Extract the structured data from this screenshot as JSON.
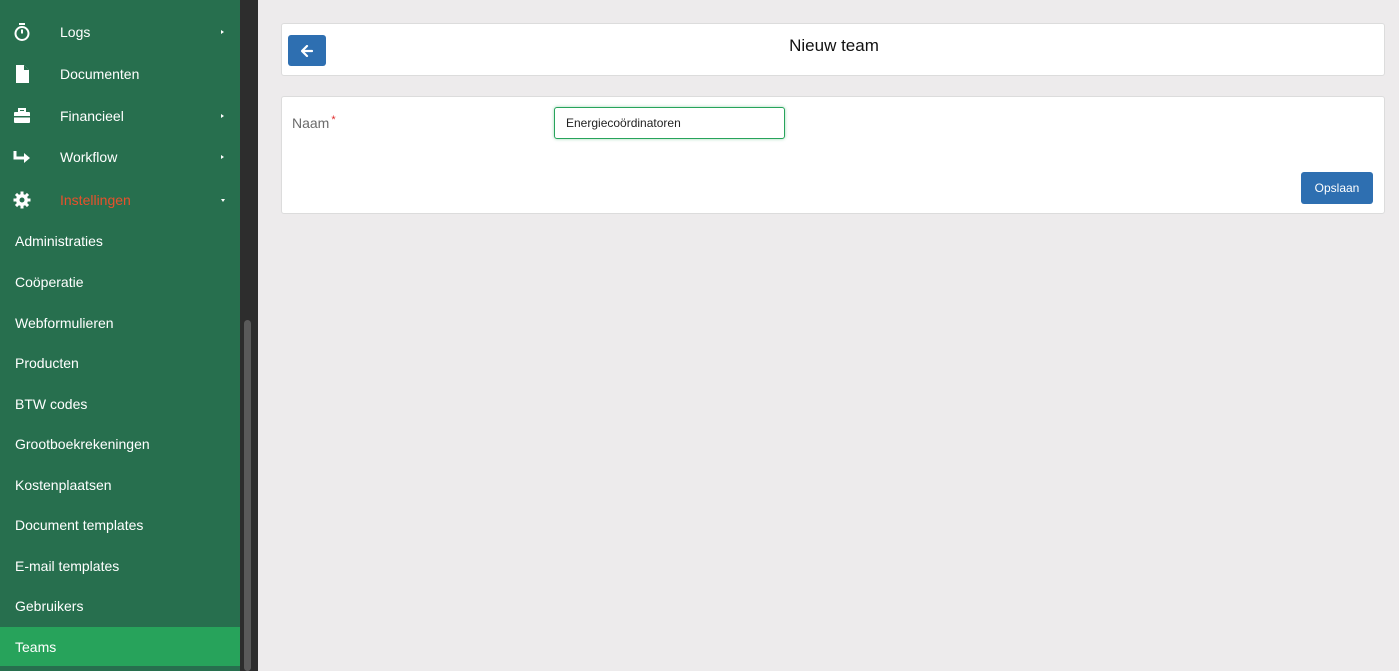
{
  "sidebar": {
    "items": [
      {
        "label": "Logs",
        "icon": "stopwatch-icon"
      },
      {
        "label": "Documenten",
        "icon": "file-icon"
      },
      {
        "label": "Financieel",
        "icon": "briefcase-icon"
      },
      {
        "label": "Workflow",
        "icon": "share-arrow-icon"
      },
      {
        "label": "Instellingen",
        "icon": "gear-icon"
      }
    ],
    "subitems": [
      {
        "label": "Administraties"
      },
      {
        "label": "Coöperatie"
      },
      {
        "label": "Webformulieren"
      },
      {
        "label": "Producten"
      },
      {
        "label": "BTW codes"
      },
      {
        "label": "Grootboekrekeningen"
      },
      {
        "label": "Kostenplaatsen"
      },
      {
        "label": "Document templates"
      },
      {
        "label": "E-mail templates"
      },
      {
        "label": "Gebruikers"
      },
      {
        "label": "Teams"
      }
    ]
  },
  "header": {
    "title": "Nieuw team",
    "back_icon": "arrow-left-icon"
  },
  "form": {
    "name_label": "Naam",
    "required_marker": "*",
    "name_value": "Energiecoördinatoren",
    "save_label": "Opslaan"
  },
  "colors": {
    "sidebar_bg": "#276f4e",
    "active_item_bg": "#27a35b",
    "active_parent_text": "#e8512b",
    "primary_button": "#2e6fb1",
    "page_bg": "#edebec"
  }
}
